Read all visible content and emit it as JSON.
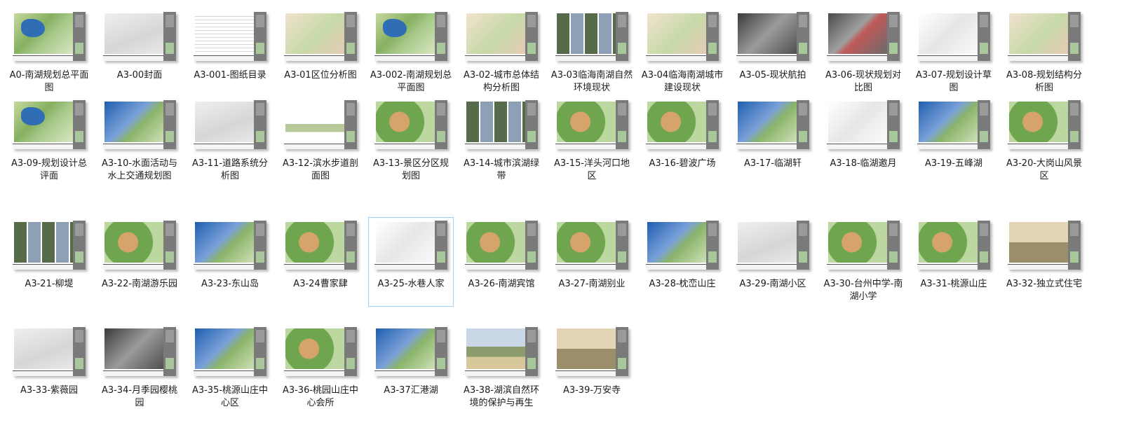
{
  "files": [
    {
      "label": "A0-南湖规划总平面图",
      "art": "map"
    },
    {
      "label": "A3-00封面",
      "art": "gray"
    },
    {
      "label": "A3-001-图纸目录",
      "art": "list"
    },
    {
      "label": "A3-01区位分析图",
      "art": "city"
    },
    {
      "label": "A3-002-南湖规划总平面图",
      "art": "map"
    },
    {
      "label": "A3-02-城市总体结构分析图",
      "art": "city"
    },
    {
      "label": "A3-03临海南湖自然环境现状",
      "art": "photos"
    },
    {
      "label": "A3-04临海南湖城市建设现状",
      "art": "city"
    },
    {
      "label": "A3-05-现状航拍",
      "art": "aerial"
    },
    {
      "label": "A3-06-现状规划对比图",
      "art": "aerial-r"
    },
    {
      "label": "A3-07-规划设计草图",
      "art": "sketch"
    },
    {
      "label": "A3-08-规划结构分析图",
      "art": "city"
    },
    {
      "label": "A3-09-规划设计总评面",
      "art": "map"
    },
    {
      "label": "A3-10-水面活动与水上交通规划图",
      "art": "blue"
    },
    {
      "label": "A3-11-道路系统分析图",
      "art": "gray"
    },
    {
      "label": "A3-12-滨水步道剖面图",
      "art": "section"
    },
    {
      "label": "A3-13-景区分区规划图",
      "art": "green"
    },
    {
      "label": "A3-14-城市滨湖绿带",
      "art": "photos"
    },
    {
      "label": "A3-15-洋头河口地区",
      "art": "green"
    },
    {
      "label": "A3-16-碧波广场",
      "art": "green"
    },
    {
      "label": "A3-17-临湖轩",
      "art": "blue"
    },
    {
      "label": "A3-18-临湖邀月",
      "art": "sketch"
    },
    {
      "label": "A3-19-五峰湖",
      "art": "blue"
    },
    {
      "label": "A3-20-大岗山风景区",
      "art": "green"
    },
    {
      "label": "A3-21-柳堤",
      "art": "photos"
    },
    {
      "label": "A3-22-南湖游乐园",
      "art": "green"
    },
    {
      "label": "A3-23-东山岛",
      "art": "blue"
    },
    {
      "label": "A3-24曹家肆",
      "art": "green"
    },
    {
      "label": "A3-25-水巷人家",
      "art": "sketch"
    },
    {
      "label": "A3-26-南湖宾馆",
      "art": "green"
    },
    {
      "label": "A3-27-南湖别业",
      "art": "green"
    },
    {
      "label": "A3-28-枕峦山庄",
      "art": "blue"
    },
    {
      "label": "A3-29-南湖小区",
      "art": "gray"
    },
    {
      "label": "A3-30-台州中学-南湖小学",
      "art": "green"
    },
    {
      "label": "A3-31-桃源山庄",
      "art": "green"
    },
    {
      "label": "A3-32-独立式住宅",
      "art": "paint"
    },
    {
      "label": "A3-33-紫薇园",
      "art": "gray"
    },
    {
      "label": "A3-34-月季园樱桃园",
      "art": "aerial"
    },
    {
      "label": "A3-35-桃源山庄中心区",
      "art": "blue"
    },
    {
      "label": "A3-36-桃园山庄中心会所",
      "art": "green"
    },
    {
      "label": "A3-37汇港湖",
      "art": "blue"
    },
    {
      "label": "A3-38-湖滨自然环境的保护与再生",
      "art": "photo"
    },
    {
      "label": "A3-39-万安寺",
      "art": "paint"
    }
  ],
  "selected_label": "A3-25-水巷人家",
  "colors": {
    "selection_border": "#99d1ff",
    "side_bar": "#7a7a7a"
  }
}
